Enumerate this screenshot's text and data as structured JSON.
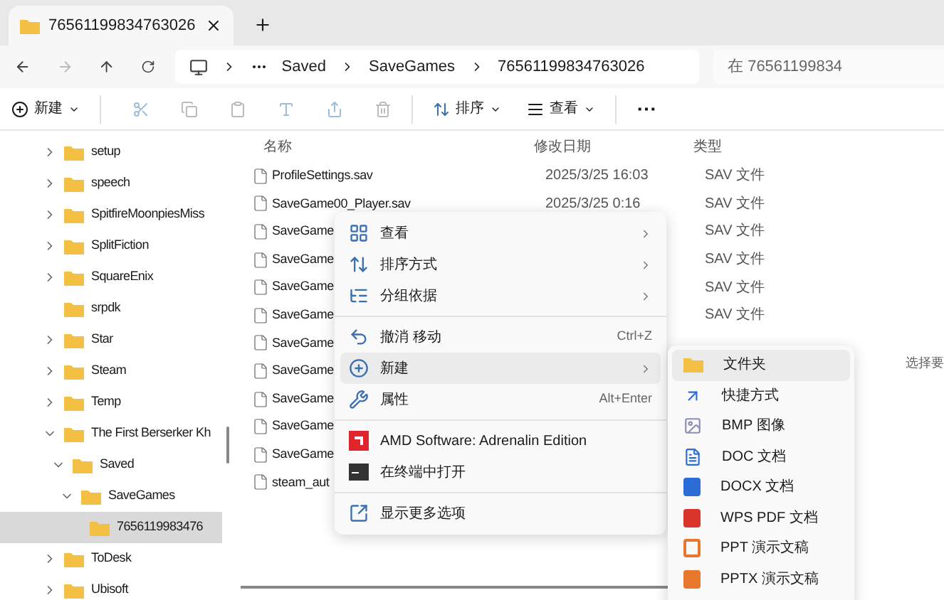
{
  "tab": {
    "title": "76561199834763026",
    "selected": true
  },
  "address": {
    "crumbs": [
      "Saved",
      "SaveGames",
      "76561199834763026"
    ]
  },
  "search": {
    "placeholder": "在 76561199834"
  },
  "toolbar": {
    "new": "新建",
    "sort": "排序",
    "view": "查看",
    "more": "⋯"
  },
  "sidebar": {
    "items": [
      {
        "label": "setup",
        "expandable": true,
        "expanded": false,
        "selected": false
      },
      {
        "label": "speech",
        "expandable": true,
        "expanded": false,
        "selected": false
      },
      {
        "label": "SpitfireMoonpiesMiss",
        "expandable": true,
        "expanded": false,
        "selected": false
      },
      {
        "label": "SplitFiction",
        "expandable": true,
        "expanded": false,
        "selected": false
      },
      {
        "label": "SquareEnix",
        "expandable": true,
        "expanded": false,
        "selected": false
      },
      {
        "label": "srpdk",
        "expandable": false,
        "selected": false
      },
      {
        "label": "Star",
        "expandable": true,
        "expanded": false,
        "selected": false
      },
      {
        "label": "Steam",
        "expandable": true,
        "expanded": false,
        "selected": false
      },
      {
        "label": "Temp",
        "expandable": true,
        "expanded": false,
        "selected": false
      },
      {
        "label": "The First Berserker Kh",
        "expandable": true,
        "expanded": true,
        "selected": false,
        "children": [
          {
            "label": "Saved",
            "expandable": true,
            "expanded": true,
            "selected": false,
            "children": [
              {
                "label": "SaveGames",
                "expandable": true,
                "expanded": true,
                "selected": false,
                "children": [
                  {
                    "label": "7656119983476",
                    "expandable": false,
                    "selected": true
                  }
                ]
              }
            ]
          }
        ]
      },
      {
        "label": "ToDesk",
        "expandable": true,
        "expanded": false,
        "selected": false
      },
      {
        "label": "Ubisoft",
        "expandable": true,
        "expanded": false,
        "selected": false
      }
    ]
  },
  "table": {
    "columns": [
      "名称",
      "修改日期",
      "类型"
    ],
    "rows": [
      {
        "name": "ProfileSettings.sav",
        "date": "2025/3/25 16:03",
        "type": "SAV 文件"
      },
      {
        "name": "SaveGame00_Player.sav",
        "date": "2025/3/25 0:16",
        "type": "SAV 文件"
      },
      {
        "name": "SaveGame",
        "type": "SAV 文件"
      },
      {
        "name": "SaveGame",
        "type": "SAV 文件"
      },
      {
        "name": "SaveGame",
        "type": "SAV 文件"
      },
      {
        "name": "SaveGame",
        "type": "SAV 文件"
      },
      {
        "name": "SaveGame"
      },
      {
        "name": "SaveGame"
      },
      {
        "name": "SaveGame"
      },
      {
        "name": "SaveGame"
      },
      {
        "name": "SaveGame"
      },
      {
        "name": "steam_aut"
      }
    ]
  },
  "details_hint": "选择要",
  "context_menu": {
    "items": [
      {
        "kind": "item",
        "label": "查看",
        "submenu": true,
        "selected": false
      },
      {
        "kind": "item",
        "label": "排序方式",
        "submenu": true,
        "selected": false
      },
      {
        "kind": "item",
        "label": "分组依据",
        "submenu": true,
        "selected": false
      },
      {
        "kind": "divider"
      },
      {
        "kind": "item",
        "label": "撤消 移动",
        "shortcut": "Ctrl+Z",
        "submenu": false,
        "selected": false
      },
      {
        "kind": "item",
        "label": "新建",
        "submenu": true,
        "selected": true
      },
      {
        "kind": "item",
        "label": "属性",
        "shortcut": "Alt+Enter",
        "submenu": false,
        "selected": false
      },
      {
        "kind": "divider"
      },
      {
        "kind": "item",
        "label": "AMD Software: Adrenalin Edition",
        "submenu": false,
        "selected": false
      },
      {
        "kind": "item",
        "label": "在终端中打开",
        "submenu": false,
        "selected": false
      },
      {
        "kind": "divider"
      },
      {
        "kind": "item",
        "label": "显示更多选项",
        "submenu": false,
        "selected": false
      }
    ]
  },
  "submenu": {
    "items": [
      {
        "label": "文件夹",
        "selected": true
      },
      {
        "label": "快捷方式",
        "selected": false
      },
      {
        "label": "BMP 图像",
        "selected": false
      },
      {
        "label": "DOC 文档",
        "selected": false
      },
      {
        "label": "DOCX 文档",
        "selected": false
      },
      {
        "label": "WPS PDF 文档",
        "selected": false
      },
      {
        "label": "PPT 演示文稿",
        "selected": false
      },
      {
        "label": "PPTX 演示文稿",
        "selected": false
      }
    ]
  }
}
